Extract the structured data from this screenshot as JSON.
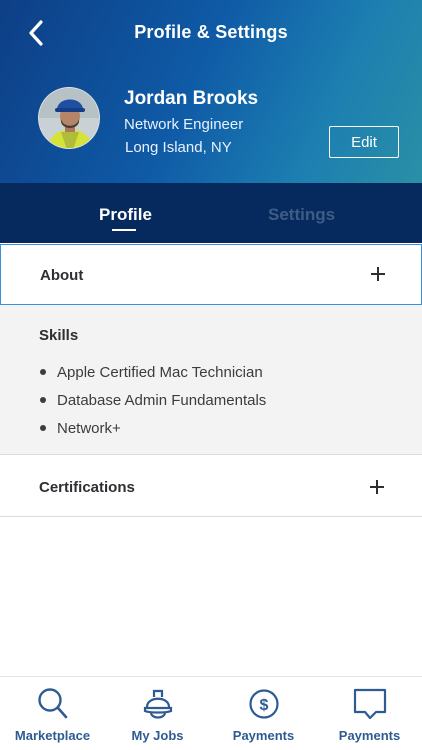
{
  "header": {
    "title": "Profile & Settings",
    "back_icon": "chevron-left-icon",
    "gradient_colors": [
      "#0d3f86",
      "#1c7fb1",
      "#2a8fa6"
    ]
  },
  "profile": {
    "name": "Jordan Brooks",
    "role": "Network Engineer",
    "location": "Long Island, NY",
    "edit_label": "Edit"
  },
  "tabs": [
    {
      "label": "Profile",
      "active": true
    },
    {
      "label": "Settings",
      "active": false
    }
  ],
  "sections": {
    "about": {
      "label": "About",
      "icon": "plus-icon"
    },
    "skills": {
      "label": "Skills",
      "items": [
        "Apple Certified Mac Technician",
        "Database Admin Fundamentals",
        "Network+"
      ]
    },
    "certifications": {
      "label": "Certifications",
      "icon": "plus-icon"
    }
  },
  "bottom_nav": [
    {
      "label": "Marketplace",
      "icon": "search-icon"
    },
    {
      "label": "My Jobs",
      "icon": "hard-hat-icon"
    },
    {
      "label": "Payments",
      "icon": "dollar-circle-icon"
    },
    {
      "label": "Payments",
      "icon": "chat-bubble-icon"
    }
  ],
  "colors": {
    "tab_bar": "#062a5e",
    "accent_border": "#3b8fe0",
    "nav_label": "#2f5b93",
    "inactive_tab": "#3f5c86"
  }
}
